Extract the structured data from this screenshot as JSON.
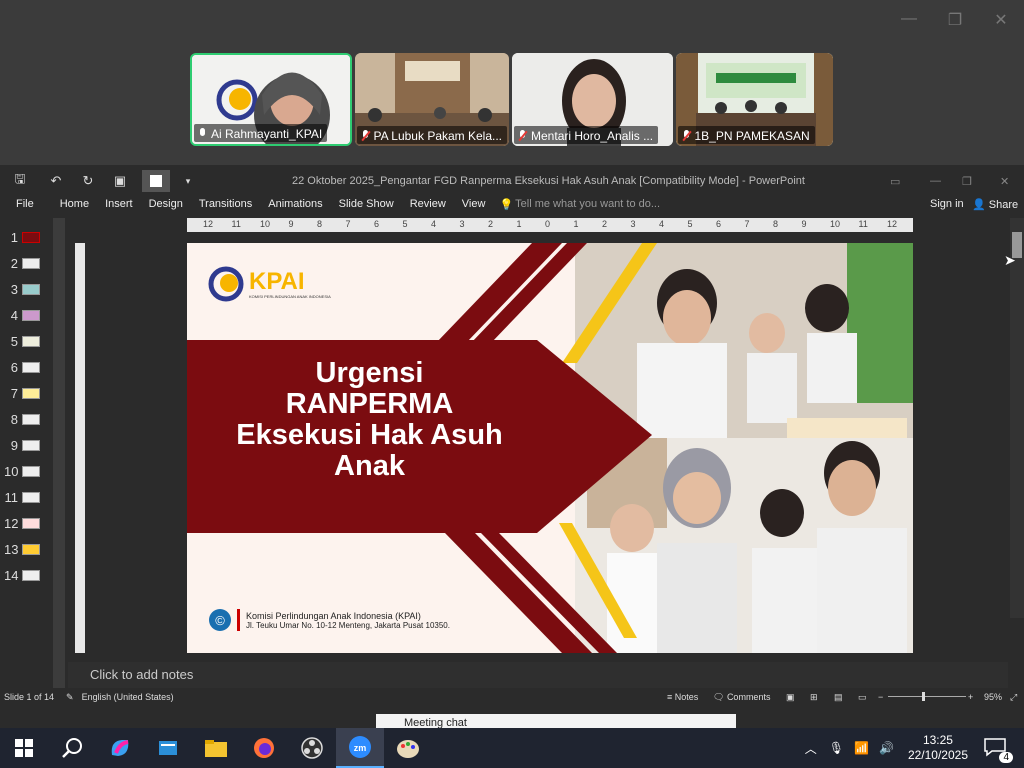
{
  "zoom": {
    "participants": [
      {
        "name": "Ai Rahmayanti_KPAI",
        "muted": false,
        "active": true
      },
      {
        "name": "PA Lubuk Pakam Kela...",
        "muted": true,
        "active": false
      },
      {
        "name": "Mentari Horo_Analis ...",
        "muted": true,
        "active": false
      },
      {
        "name": "1B_PN PAMEKASAN",
        "muted": true,
        "active": false
      }
    ],
    "window_controls": {
      "minimize": "—",
      "restore": "❐",
      "close": "✕"
    }
  },
  "powerpoint": {
    "title": "22 Oktober 2025_Pengantar FGD Ranperma Eksekusi Hak Asuh Anak [Compatibility Mode] - PowerPoint",
    "menu": [
      "File",
      "Home",
      "Insert",
      "Design",
      "Transitions",
      "Animations",
      "Slide Show",
      "Review",
      "View"
    ],
    "tell_me": "Tell me what you want to do...",
    "sign_in": "Sign in",
    "share": "Share",
    "slide_numbers": [
      "1",
      "2",
      "3",
      "4",
      "5",
      "6",
      "7",
      "8",
      "9",
      "10",
      "11",
      "12",
      "13",
      "14"
    ],
    "ruler_labels": [
      "12",
      "11",
      "10",
      "9",
      "8",
      "7",
      "6",
      "5",
      "4",
      "3",
      "2",
      "1",
      "0",
      "1",
      "2",
      "3",
      "4",
      "5",
      "6",
      "7",
      "8",
      "9",
      "10",
      "11",
      "12"
    ],
    "notes_placeholder": "Click to add notes",
    "status": {
      "slide": "Slide 1 of 14",
      "language": "English (United States)",
      "notes": "Notes",
      "comments": "Comments",
      "zoom": "95%"
    }
  },
  "slide": {
    "logo_text": "KPAI",
    "logo_sub": "KOMISI PERLINDUNGAN ANAK INDONESIA",
    "title_lines": [
      "Urgensi",
      "RANPERMA",
      "Eksekusi Hak Asuh",
      "Anak"
    ],
    "footer_org": "Komisi Perlindungan Anak Indonesia (KPAI)",
    "footer_addr": "Jl. Teuku Umar No. 10-12 Menteng, Jakarta Pusat 10350.",
    "colors": {
      "maroon": "#7b0c10",
      "yellow": "#f5c518",
      "bg": "#fdf3ee",
      "logo_blue": "#2f3a8f",
      "logo_yellow": "#f7b500"
    }
  },
  "popup": {
    "title": "Meeting chat"
  },
  "taskbar": {
    "apps": [
      "windows-start",
      "search",
      "copilot",
      "notes",
      "file-explorer",
      "firefox",
      "obs",
      "zoom",
      "paint"
    ],
    "time": "13:25",
    "date": "22/10/2025",
    "notifications": "4"
  }
}
